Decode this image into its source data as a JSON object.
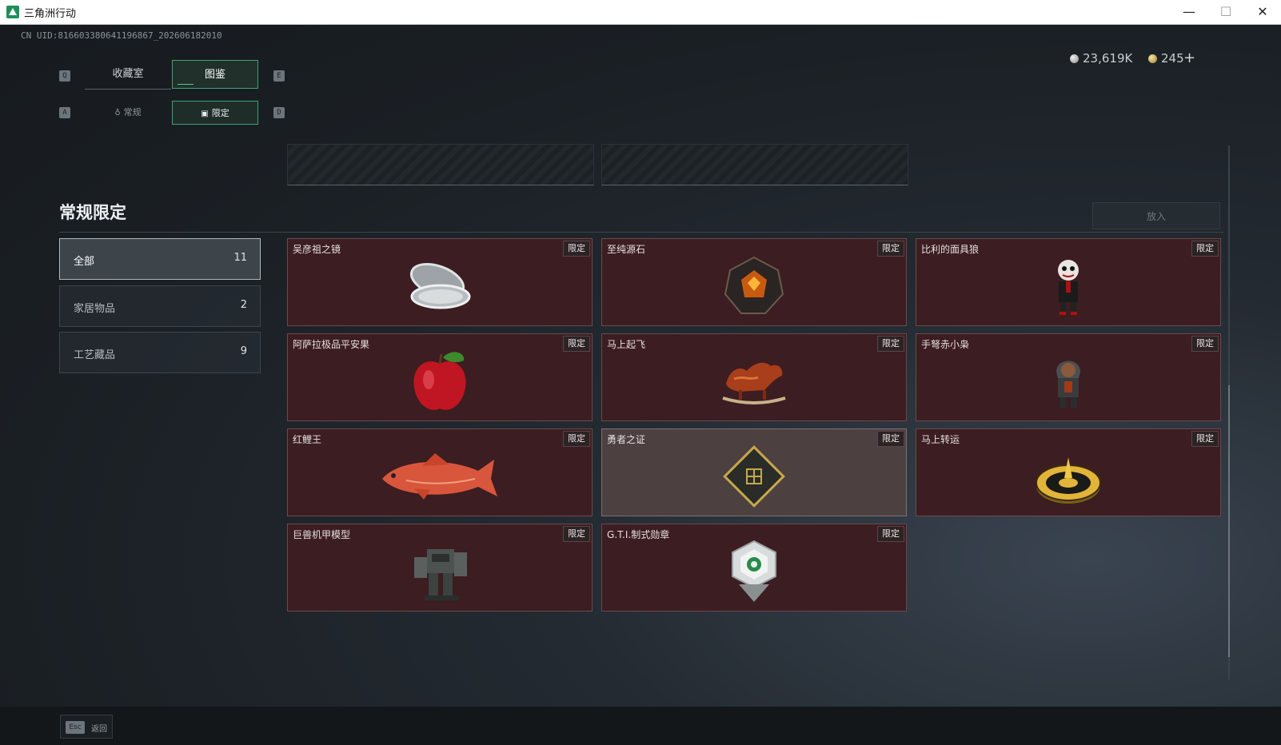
{
  "window": {
    "title": "三角洲行动",
    "min": "—",
    "max": "☐",
    "close": "✕"
  },
  "uid": "CN UID:816603380641196867_202606182010",
  "currency": {
    "silver": "23,619K",
    "gold": "245",
    "plus": "+"
  },
  "keys": {
    "q": "Q",
    "e": "E",
    "a": "A",
    "d": "D"
  },
  "tabs": [
    {
      "label": "收藏室"
    },
    {
      "label": "图鉴"
    }
  ],
  "subtabs": [
    {
      "label": "常规",
      "icon": "♁"
    },
    {
      "label": "限定",
      "icon": "▣"
    }
  ],
  "section": {
    "title": "常规限定",
    "put_button": "放入"
  },
  "categories": [
    {
      "label": "全部",
      "count": "11"
    },
    {
      "label": "家居物品",
      "count": "2"
    },
    {
      "label": "工艺藏品",
      "count": "9"
    }
  ],
  "items": [
    {
      "name": "吴彦祖之镜",
      "tag": "限定",
      "icon": "compact-mirror-icon"
    },
    {
      "name": "至纯源石",
      "tag": "限定",
      "icon": "source-stone-icon"
    },
    {
      "name": "比利的面具狼",
      "tag": "限定",
      "icon": "puppet-figure-icon"
    },
    {
      "name": "阿萨拉极品平安果",
      "tag": "限定",
      "icon": "apple-icon"
    },
    {
      "name": "马上起飞",
      "tag": "限定",
      "icon": "rocking-horse-icon"
    },
    {
      "name": "手弩赤小枭",
      "tag": "限定",
      "icon": "hooded-figure-icon"
    },
    {
      "name": "红鲤王",
      "tag": "限定",
      "icon": "carp-icon"
    },
    {
      "name": "勇者之证",
      "tag": "限定",
      "icon": "emblem-card-icon"
    },
    {
      "name": "马上转运",
      "tag": "限定",
      "icon": "gold-compass-icon"
    },
    {
      "name": "巨兽机甲模型",
      "tag": "限定",
      "icon": "mech-model-icon"
    },
    {
      "name": "G.T.I.制式勋章",
      "tag": "限定",
      "icon": "medal-icon"
    }
  ],
  "footer": {
    "esc_key": "Esc",
    "esc_label": "返回"
  },
  "colors": {
    "accent": "#3ea273",
    "card": "#3c1d21",
    "card_selected": "#4d4041"
  }
}
